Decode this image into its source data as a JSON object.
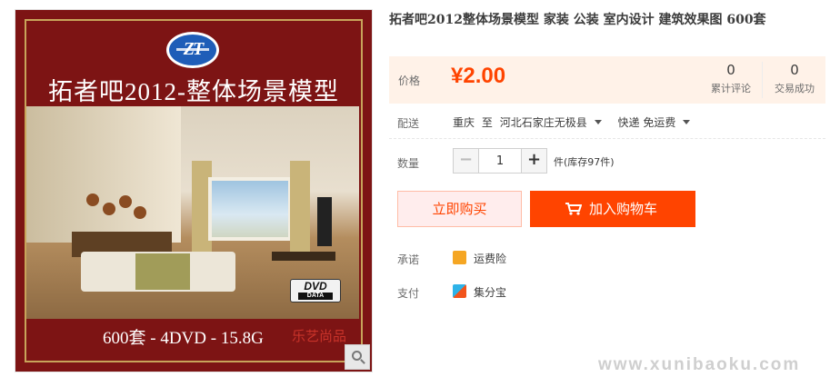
{
  "product": {
    "title": "拓者吧2012整体场景模型 家装 公装 室内设计 建筑效果图 600套",
    "cover": {
      "logo_text": "ZT",
      "title": "拓者吧2012-整体场景模型",
      "bottom_text": "600套 - 4DVD - 15.8G",
      "dvd_badge": "DVD",
      "dvd_sub": "DATA",
      "watermark": "乐艺尚品"
    }
  },
  "price": {
    "label": "价格",
    "value": "¥2.00",
    "stats": [
      {
        "num": "0",
        "label": "累计评论"
      },
      {
        "num": "0",
        "label": "交易成功"
      }
    ]
  },
  "shipping": {
    "label": "配送",
    "from": "重庆",
    "to_word": "至",
    "destination": "河北石家庄无极县",
    "method": "快递 免运费"
  },
  "quantity": {
    "label": "数量",
    "minus": "−",
    "plus": "+",
    "value": "1",
    "stock": "件(库存97件)"
  },
  "buttons": {
    "buy_now": "立即购买",
    "add_cart": "加入购物车"
  },
  "promise": {
    "label": "承诺",
    "item": "运费险"
  },
  "payment": {
    "label": "支付",
    "item": "集分宝"
  },
  "watermark": "www.xunibaoku.com",
  "colors": {
    "accent": "#ff4400",
    "price_bg": "#fff2e8",
    "cover_bg": "#7d1414"
  },
  "icons": [
    "search-zoom-icon",
    "cart-icon",
    "freight-insurance-icon",
    "jifenbao-icon",
    "dropdown-caret-icon"
  ]
}
